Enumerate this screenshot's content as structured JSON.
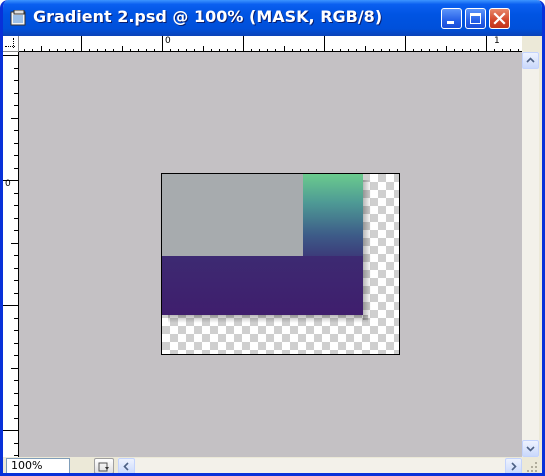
{
  "window": {
    "title": "Gradient 2.psd @ 100% (MASK, RGB/8)",
    "icon": "photoshop-document-icon",
    "controls": [
      "minimize-icon",
      "maximize-icon",
      "close-icon"
    ]
  },
  "rulers": {
    "horizontal_labels": [
      "0",
      "1"
    ],
    "vertical_labels": [
      "0"
    ]
  },
  "status_bar": {
    "zoom": "100%",
    "menu_icon": "status-menu-arrow-icon"
  },
  "colors": {
    "titlebar": "#0054E3",
    "canvas_background": "#C4C1C4",
    "gradient_top": "#6BCB8D",
    "gradient_bottom": "#3F1E6D",
    "gray_block": "#A7ABAE"
  }
}
